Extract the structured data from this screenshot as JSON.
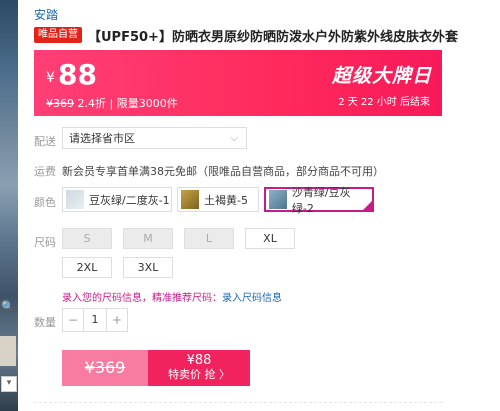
{
  "brand": "安踏",
  "badge": "唯品自营",
  "title": "【UPF50+】防晒衣男原纱防晒防泼水户外防紫外线皮肤衣外套",
  "promo": {
    "currency": "¥",
    "price": "88",
    "original_price": "¥369",
    "discount": "2.4折",
    "limit": "限量3000件",
    "event": "超级大牌日",
    "countdown": "2 天 22 小时 后结束"
  },
  "delivery": {
    "label": "配送",
    "placeholder": "请选择省市区",
    "chevron_icon": "chevron-down"
  },
  "freight": {
    "label": "运费",
    "text": "新会员专享首单满38元免邮（限唯品自营商品，部分商品不可用）"
  },
  "colors": {
    "label": "颜色",
    "options": [
      {
        "name": "豆灰绿/二度灰-1"
      },
      {
        "name": "土褐黄-5"
      },
      {
        "name": "沙青绿/豆灰绿-2",
        "selected": true
      }
    ]
  },
  "sizes": {
    "label": "尺码",
    "options": [
      {
        "name": "S",
        "disabled": true
      },
      {
        "name": "M",
        "disabled": true
      },
      {
        "name": "L",
        "disabled": true
      },
      {
        "name": "XL",
        "disabled": false
      },
      {
        "name": "2XL",
        "disabled": false
      },
      {
        "name": "3XL",
        "disabled": false
      }
    ]
  },
  "size_hint": {
    "text": "录入您的尺码信息，精准推荐尺码：",
    "link": "录入尺码信息"
  },
  "quantity": {
    "label": "数量",
    "value": "1",
    "minus": "−",
    "plus": "+"
  },
  "buy": {
    "original": "¥369",
    "price": "¥88",
    "action": "特卖价 抢 〉"
  },
  "accent_colors": {
    "promo": "#ff2a5c",
    "selected_border": "#c81a8a",
    "link": "#1a67b3"
  }
}
